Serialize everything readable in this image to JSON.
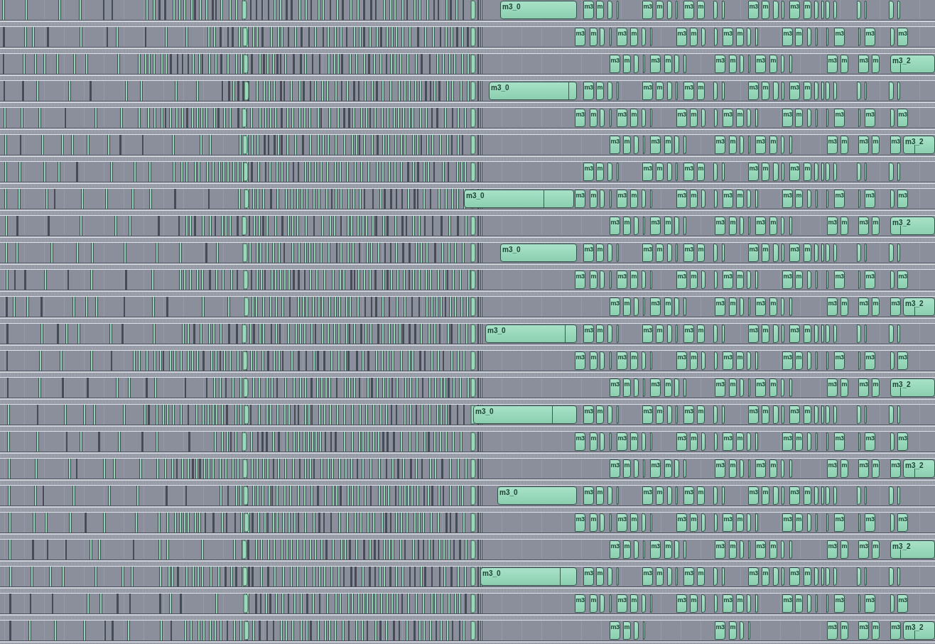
{
  "playlist": {
    "tracks": [
      {
        "clips": [
          "m3_0",
          "m3",
          "m",
          "m3",
          "m",
          "m3",
          "m",
          "m3",
          "m",
          "m3",
          "m"
        ]
      },
      {
        "clips": [
          "m3",
          "m",
          "m3",
          "m",
          "m3",
          "m",
          "m3",
          "m",
          "m3",
          "m",
          "m3",
          "m3",
          "m3"
        ]
      },
      {
        "clips": [
          "m3",
          "m",
          "m3",
          "m",
          "m3",
          "m",
          "m3",
          "m",
          "m3",
          "m",
          "m3",
          "m",
          "m3_2"
        ]
      },
      {
        "clips": [
          "m3_0",
          "m3",
          "m",
          "m3",
          "m",
          "m3",
          "m",
          "m3",
          "m",
          "m3",
          "m"
        ]
      },
      {
        "clips": [
          "m3",
          "m",
          "m3",
          "m",
          "m3",
          "m",
          "m3",
          "m",
          "m3",
          "m",
          "m3",
          "m3",
          "m3"
        ]
      },
      {
        "clips": [
          "m3",
          "m",
          "m3",
          "m",
          "m3",
          "m",
          "m3",
          "m",
          "m3",
          "m",
          "m3",
          "m",
          "m3",
          "m3_2"
        ]
      },
      {
        "clips": [
          "m3",
          "m",
          "m3",
          "m",
          "m3",
          "m",
          "m3",
          "m",
          "m3",
          "m"
        ]
      },
      {
        "clips": [
          "m3_0",
          "m3",
          "m",
          "m3",
          "m",
          "m3",
          "m",
          "m3",
          "m",
          "m3",
          "m",
          "m3",
          "m3",
          "m3"
        ]
      },
      {
        "clips": [
          "m3",
          "m",
          "m3",
          "m",
          "m3",
          "m",
          "m3",
          "m",
          "m3",
          "m",
          "m3",
          "m",
          "m3_2"
        ]
      },
      {
        "clips": [
          "m3_0",
          "m3",
          "m",
          "m3",
          "m",
          "m3",
          "m",
          "m3",
          "m",
          "m3",
          "m"
        ]
      },
      {
        "clips": [
          "m3",
          "m",
          "m3",
          "m",
          "m3",
          "m",
          "m3",
          "m",
          "m3",
          "m",
          "m3",
          "m3",
          "m3"
        ]
      },
      {
        "clips": [
          "m3",
          "m",
          "m3",
          "m",
          "m3",
          "m",
          "m3",
          "m",
          "m3",
          "m",
          "m3",
          "m",
          "m3",
          "m3_2"
        ]
      },
      {
        "clips": [
          "m3_0",
          "m3",
          "m",
          "m3",
          "m",
          "m3",
          "m",
          "m3",
          "m",
          "m3",
          "m"
        ]
      },
      {
        "clips": [
          "m3",
          "m",
          "m3",
          "m",
          "m3",
          "m",
          "m3",
          "m",
          "m3",
          "m",
          "m3",
          "m3",
          "m3"
        ]
      },
      {
        "clips": [
          "m3",
          "m",
          "m3",
          "m",
          "m3",
          "m",
          "m3",
          "m",
          "m3",
          "m",
          "m3",
          "m",
          "m3_2"
        ]
      },
      {
        "clips": [
          "m3_0",
          "m3",
          "m",
          "m3",
          "m",
          "m3",
          "m",
          "m3",
          "m",
          "m3",
          "m"
        ]
      },
      {
        "clips": [
          "m3",
          "m",
          "m3",
          "m",
          "m3",
          "m",
          "m3",
          "m",
          "m3",
          "m",
          "m3",
          "m3",
          "m3"
        ]
      },
      {
        "clips": [
          "m3",
          "m",
          "m3",
          "m",
          "m3",
          "m",
          "m3",
          "m",
          "m3",
          "m",
          "m3",
          "m",
          "m3",
          "m3_2"
        ]
      },
      {
        "clips": [
          "m3_0",
          "m3",
          "m",
          "m3",
          "m",
          "m3",
          "m",
          "m3",
          "m",
          "m3",
          "m"
        ]
      },
      {
        "clips": [
          "m3",
          "m",
          "m3",
          "m",
          "m3",
          "m",
          "m3",
          "m",
          "m3",
          "m",
          "m3",
          "m3",
          "m3"
        ]
      },
      {
        "clips": [
          "m3",
          "m",
          "m3",
          "m",
          "m3",
          "m",
          "m3",
          "m",
          "m3",
          "m",
          "m3",
          "m",
          "m3_2"
        ]
      },
      {
        "clips": [
          "m3_0",
          "m3",
          "m",
          "m3",
          "m",
          "m3",
          "m",
          "m3",
          "m",
          "m3",
          "m"
        ]
      },
      {
        "clips": [
          "m3",
          "m",
          "m3",
          "m",
          "m3",
          "m",
          "m3",
          "m",
          "m3",
          "m",
          "m3",
          "m3",
          "m3"
        ]
      },
      {
        "clips": [
          "m3",
          "m",
          "m3",
          "m",
          "m3",
          "m",
          "m3",
          "m",
          "m3",
          "m3_2"
        ]
      }
    ]
  }
}
